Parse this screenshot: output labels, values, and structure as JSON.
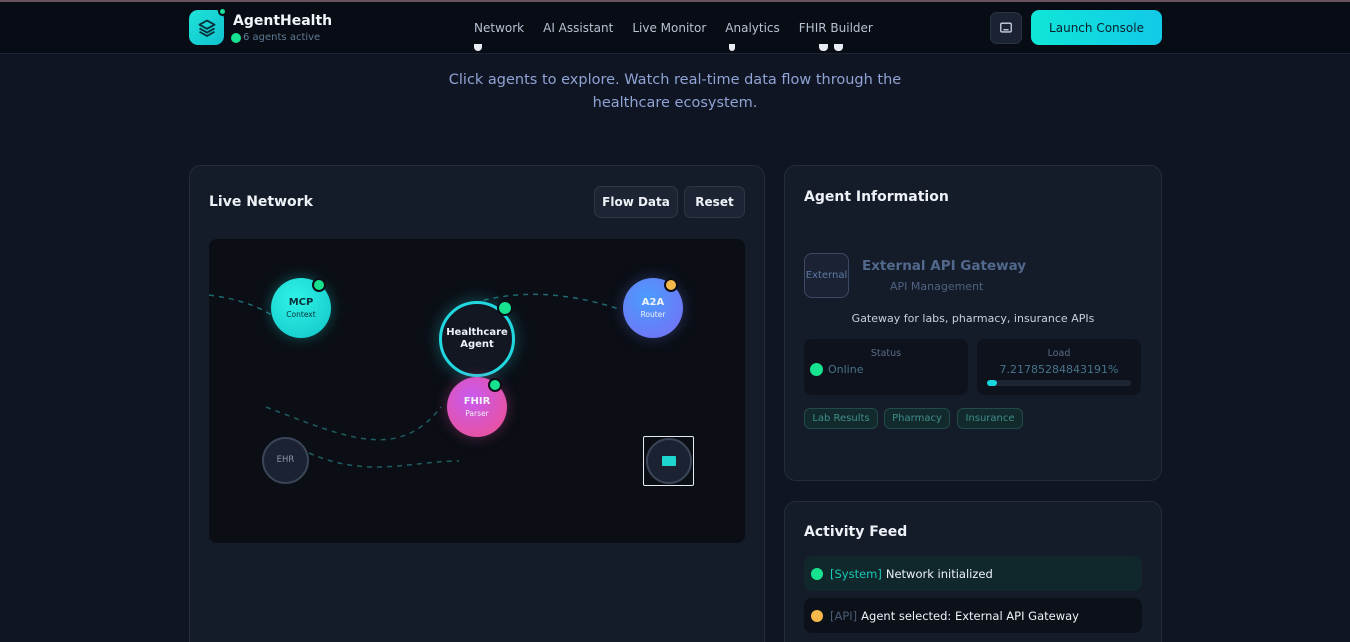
{
  "nav": {
    "brand": "AgentHealth",
    "agents_active": "6 agents active",
    "links": [
      "Network",
      "AI Assistant",
      "Live Monitor",
      "Analytics",
      "FHIR Builder"
    ],
    "launch_label": "Launch Console"
  },
  "hero": {
    "subtitle": "Click agents to explore. Watch real-time data flow through the healthcare ecosystem."
  },
  "network": {
    "title": "Live Network",
    "flow_button": "Flow Data",
    "reset_button": "Reset",
    "nodes": {
      "mcp": {
        "label": "MCP",
        "sub": "Context"
      },
      "healthcare": {
        "label": "Healthcare",
        "label2": "Agent"
      },
      "a2a": {
        "label": "A2A",
        "sub": "Router"
      },
      "fhir": {
        "label": "FHIR",
        "sub": "Parser"
      },
      "ehr": {
        "label": "EHR"
      }
    }
  },
  "agent_info": {
    "title": "Agent Information",
    "badge": "External",
    "name": "External API Gateway",
    "role": "API Management",
    "description": "Gateway for labs, pharmacy, insurance APIs",
    "status_label": "Status",
    "status_value": "Online",
    "load_label": "Load",
    "load_value": "7.21785284843191%",
    "load_fraction": 0.072,
    "tags": [
      "Lab Results",
      "Pharmacy",
      "Insurance"
    ]
  },
  "activity": {
    "title": "Activity Feed",
    "items": [
      {
        "tag": "[System]",
        "text": "Network initialized",
        "color": "#17e28f"
      },
      {
        "tag": "[API]",
        "text": "Agent selected: External API Gateway",
        "color": "#f5b84a"
      }
    ]
  },
  "colors": {
    "accent": "#10e6d8",
    "online": "#17e28f",
    "warning": "#f5b84a"
  }
}
